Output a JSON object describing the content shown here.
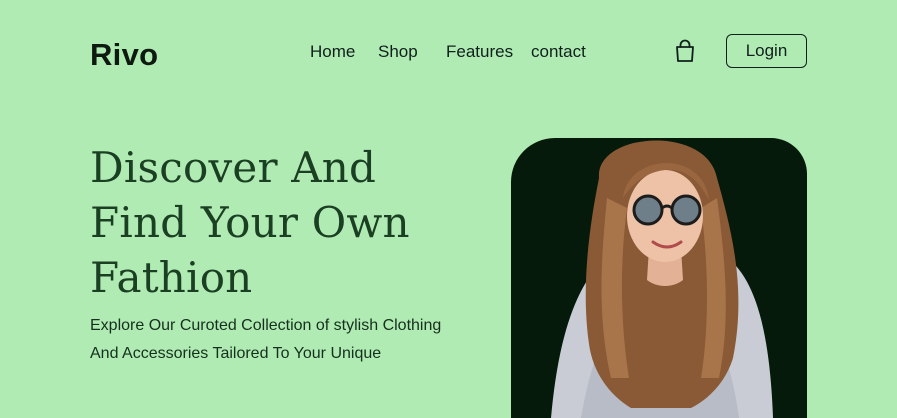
{
  "header": {
    "logo": "Rivo",
    "nav": [
      {
        "label": "Home"
      },
      {
        "label": "Shop"
      },
      {
        "label": "Features"
      },
      {
        "label": "contact"
      }
    ],
    "cart_icon": "shopping-bag-icon",
    "login_label": "Login"
  },
  "hero": {
    "headline": "Discover  And\nFind Your Own\nFathion",
    "subtext": "Explore Our Curoted Collection of stylish Clothing And Accessories Tailored To Your Unique",
    "image_subject": "model-photo"
  },
  "colors": {
    "background": "#b0ebb4",
    "card": "#051a0a",
    "headline": "#1b3f22",
    "text": "#10201a"
  }
}
